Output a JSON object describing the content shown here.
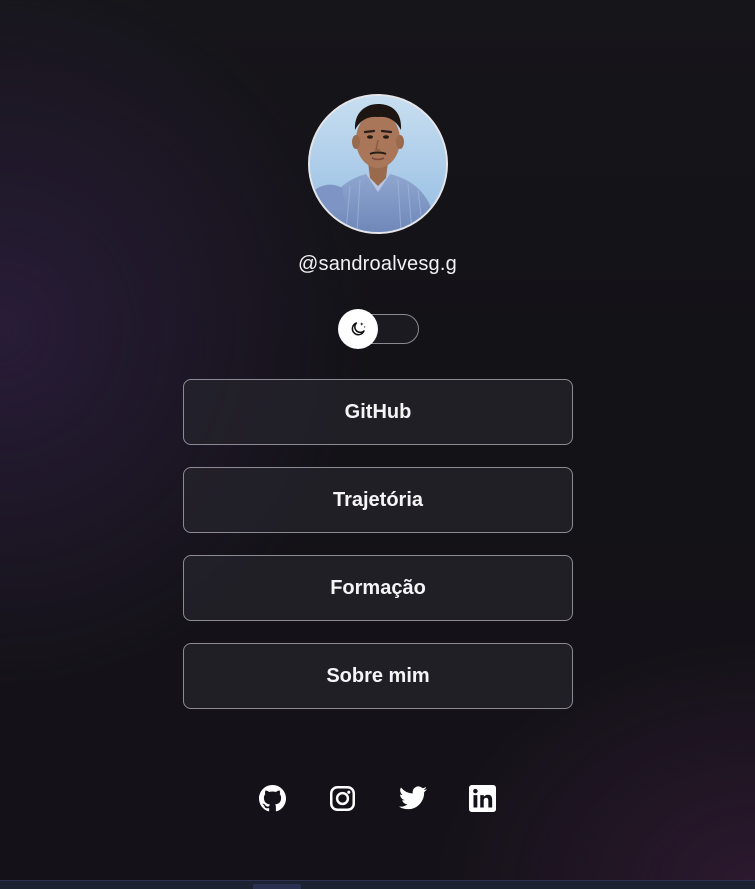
{
  "profile": {
    "username": "@sandroalvesg.g",
    "avatar_alt": "sandroalvesg.g"
  },
  "theme_toggle": {
    "icon": "moon-stars-icon",
    "state": "dark"
  },
  "links": [
    {
      "label": "GitHub"
    },
    {
      "label": "Trajetória"
    },
    {
      "label": "Formação"
    },
    {
      "label": "Sobre mim"
    }
  ],
  "social": [
    {
      "icon": "github-icon"
    },
    {
      "icon": "instagram-icon"
    },
    {
      "icon": "twitter-icon"
    },
    {
      "icon": "linkedin-icon"
    }
  ],
  "colors": {
    "background": "#141218",
    "accent_purple": "#3a2452",
    "button_bg": "#26242c",
    "button_border": "#8c8b94",
    "text": "#f5f5f7"
  }
}
